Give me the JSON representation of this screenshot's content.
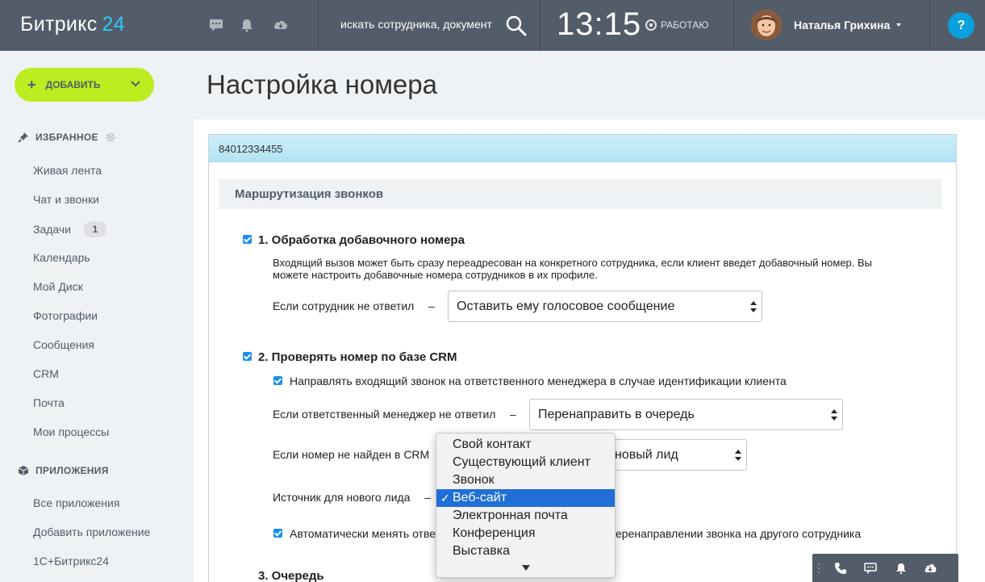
{
  "header": {
    "logo_text": "Битрикс",
    "logo_number": "24",
    "search_placeholder": "искать сотрудника, документ",
    "clock": "13:15",
    "work_status": "РАБОТАЮ",
    "user_name": "Наталья Грихина",
    "help_label": "?"
  },
  "sidebar": {
    "add_button": "ДОБАВИТЬ",
    "favorites_title": "ИЗБРАННОЕ",
    "favorites": [
      "Живая лента",
      "Чат и звонки",
      "Задачи",
      "Календарь",
      "Мой Диск",
      "Фотографии",
      "Сообщения",
      "CRM",
      "Почта",
      "Мои процессы"
    ],
    "tasks_badge": "1",
    "apps_title": "ПРИЛОЖЕНИЯ",
    "apps": [
      "Все приложения",
      "Добавить приложение",
      "1С+Битрикс24"
    ]
  },
  "main": {
    "page_title": "Настройка номера",
    "phone_number": "84012334455",
    "section_title": "Маршрутизация звонков",
    "step1": {
      "title": "1. Обработка добавочного номера",
      "desc_line1": "Входящий вызов может быть сразу переадресован на конкретного сотрудника, если клиент введет добавочный номер. Вы",
      "desc_line2": "можете настроить добавочные номера сотрудников в их профиле.",
      "no_answer_label": "Если сотрудник не ответил",
      "no_answer_value": "Оставить ему голосовое сообщение"
    },
    "step2": {
      "title": "2. Проверять номер по базе CRM",
      "route_manager_label": "Направлять входящий звонок на ответственного менеджера в случае идентификации клиента",
      "manager_no_answer_label": "Если ответственный менеджер не ответил",
      "manager_no_answer_value": "Перенаправить в очередь",
      "not_found_label": "Если номер не найден в CRM",
      "not_found_value_visible": "новый лид",
      "lead_source_label": "Источник для нового лида",
      "auto_change_label_left": "Автоматически менять отве",
      "auto_change_label_right": "еренаправлении звонка на другого сотрудника"
    },
    "step3": {
      "title": "3. Очередь"
    },
    "dash": "–"
  },
  "dropdown": {
    "options": [
      "Свой контакт",
      "Существующий клиент",
      "Звонок",
      "Веб-сайт",
      "Электронная почта",
      "Конференция",
      "Выставка"
    ],
    "selected": "Веб-сайт"
  },
  "colors": {
    "header_bg": "#535c69",
    "accent_green": "#bbed21",
    "accent_blue": "#2fc6f6",
    "checkbox_blue": "#1b8ef2",
    "selection_blue": "#1f6fd6"
  }
}
